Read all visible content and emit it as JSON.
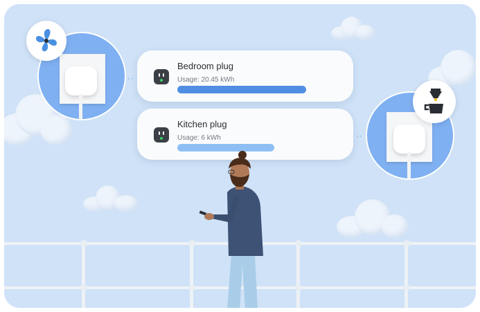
{
  "plugs": [
    {
      "name": "Bedroom plug",
      "usage": "Usage: 20.45 kWh",
      "usage_kwh": 20.45,
      "bar_color": "#4f8ee3",
      "device_icon": "fan-icon"
    },
    {
      "name": "Kitchen plug",
      "usage": "Usage: 6 kWh",
      "usage_kwh": 6,
      "bar_color": "#8ebff4",
      "device_icon": "coffee-maker-icon"
    }
  ],
  "colors": {
    "sky": "#cfe2f7",
    "accent_blue": "#7fb0f2",
    "plug_icon": "#3b3f46",
    "status_led": "#3ad06b"
  },
  "icons": [
    "fan-icon",
    "coffee-maker-icon",
    "smart-plug-icon"
  ]
}
